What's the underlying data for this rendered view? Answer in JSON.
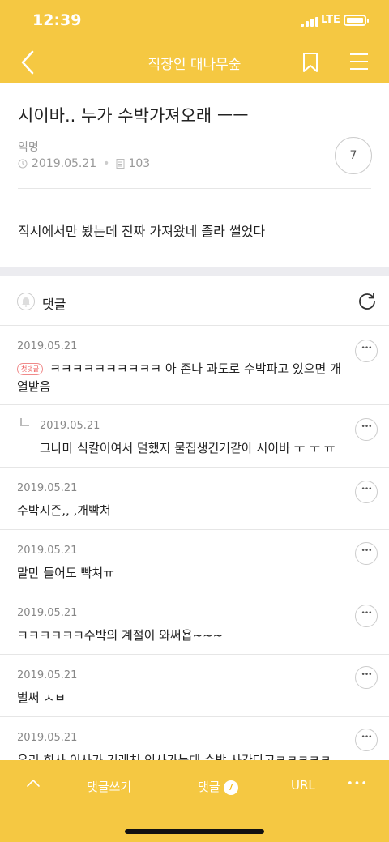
{
  "status": {
    "time": "12:39",
    "network": "LTE"
  },
  "nav": {
    "title": "직장인 대나무숲"
  },
  "post": {
    "title": "시이바.. 누가 수박가져오래 ㅡㅡ",
    "author": "익명",
    "date": "2019.05.21",
    "views": "103",
    "comment_count": "7",
    "body": "직시에서만 봤는데 진짜 가져왔네 졸라 썰었다"
  },
  "comments_header": {
    "label": "댓글"
  },
  "comments": [
    {
      "date": "2019.05.21",
      "badge": "첫댓글",
      "text": "ㅋㅋㅋㅋㅋㅋㅋㅋㅋㅋ 아 존나 과도로 수박파고 있으면 개 열받음"
    },
    {
      "date": "2019.05.21",
      "text": "그나마 식칼이여서 덜했지 물집생긴거같아 시이바 ㅜ ㅜ ㅠ"
    },
    {
      "date": "2019.05.21",
      "text": "수박시즌,, ,개빡쳐"
    },
    {
      "date": "2019.05.21",
      "text": "말만 들어도 빡쳐ㅠ"
    },
    {
      "date": "2019.05.21",
      "text": "ㅋㅋㅋㅋㅋㅋ수박의 계절이 와써욥~~~"
    },
    {
      "date": "2019.05.21",
      "text": "벌써 ㅅㅂ"
    },
    {
      "date": "2019.05.21",
      "text": "우리 회사 이사가 거래처 인사가는데 수박 사간다고ㅋㅋㅋㅋㅋ"
    }
  ],
  "bottom_bar": {
    "write": "댓글쓰기",
    "comments": "댓글",
    "comments_count": "7",
    "url": "URL",
    "more": "•••"
  },
  "colors": {
    "accent": "#f5c842",
    "divider": "#e6e6e6",
    "meta_text": "#999999"
  }
}
